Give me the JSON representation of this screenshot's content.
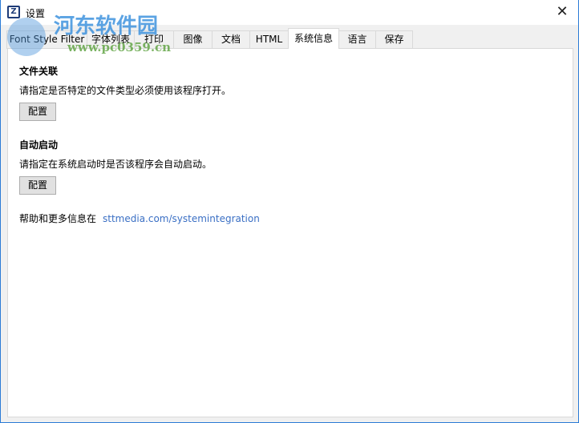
{
  "window": {
    "title": "设置",
    "close_icon": "close-icon"
  },
  "tabs": [
    {
      "label": "Font Style Filter",
      "selected": false
    },
    {
      "label": "字体列表",
      "selected": false
    },
    {
      "label": "打印",
      "selected": false
    },
    {
      "label": "图像",
      "selected": false
    },
    {
      "label": "文档",
      "selected": false
    },
    {
      "label": "HTML",
      "selected": false
    },
    {
      "label": "系统信息",
      "selected": true
    },
    {
      "label": "语言",
      "selected": false
    },
    {
      "label": "保存",
      "selected": false
    }
  ],
  "file_assoc": {
    "heading": "文件关联",
    "description": "请指定是否特定的文件类型必须使用该程序打开。",
    "button": "配置"
  },
  "autostart": {
    "heading": "自动启动",
    "description": "请指定在系统启动时是否该程序会自动启动。",
    "button": "配置"
  },
  "help": {
    "text": "帮助和更多信息在",
    "link": "sttmedia.com/systemintegration"
  },
  "watermark": {
    "name": "河东软件园",
    "url": "www.pc0359.cn"
  }
}
